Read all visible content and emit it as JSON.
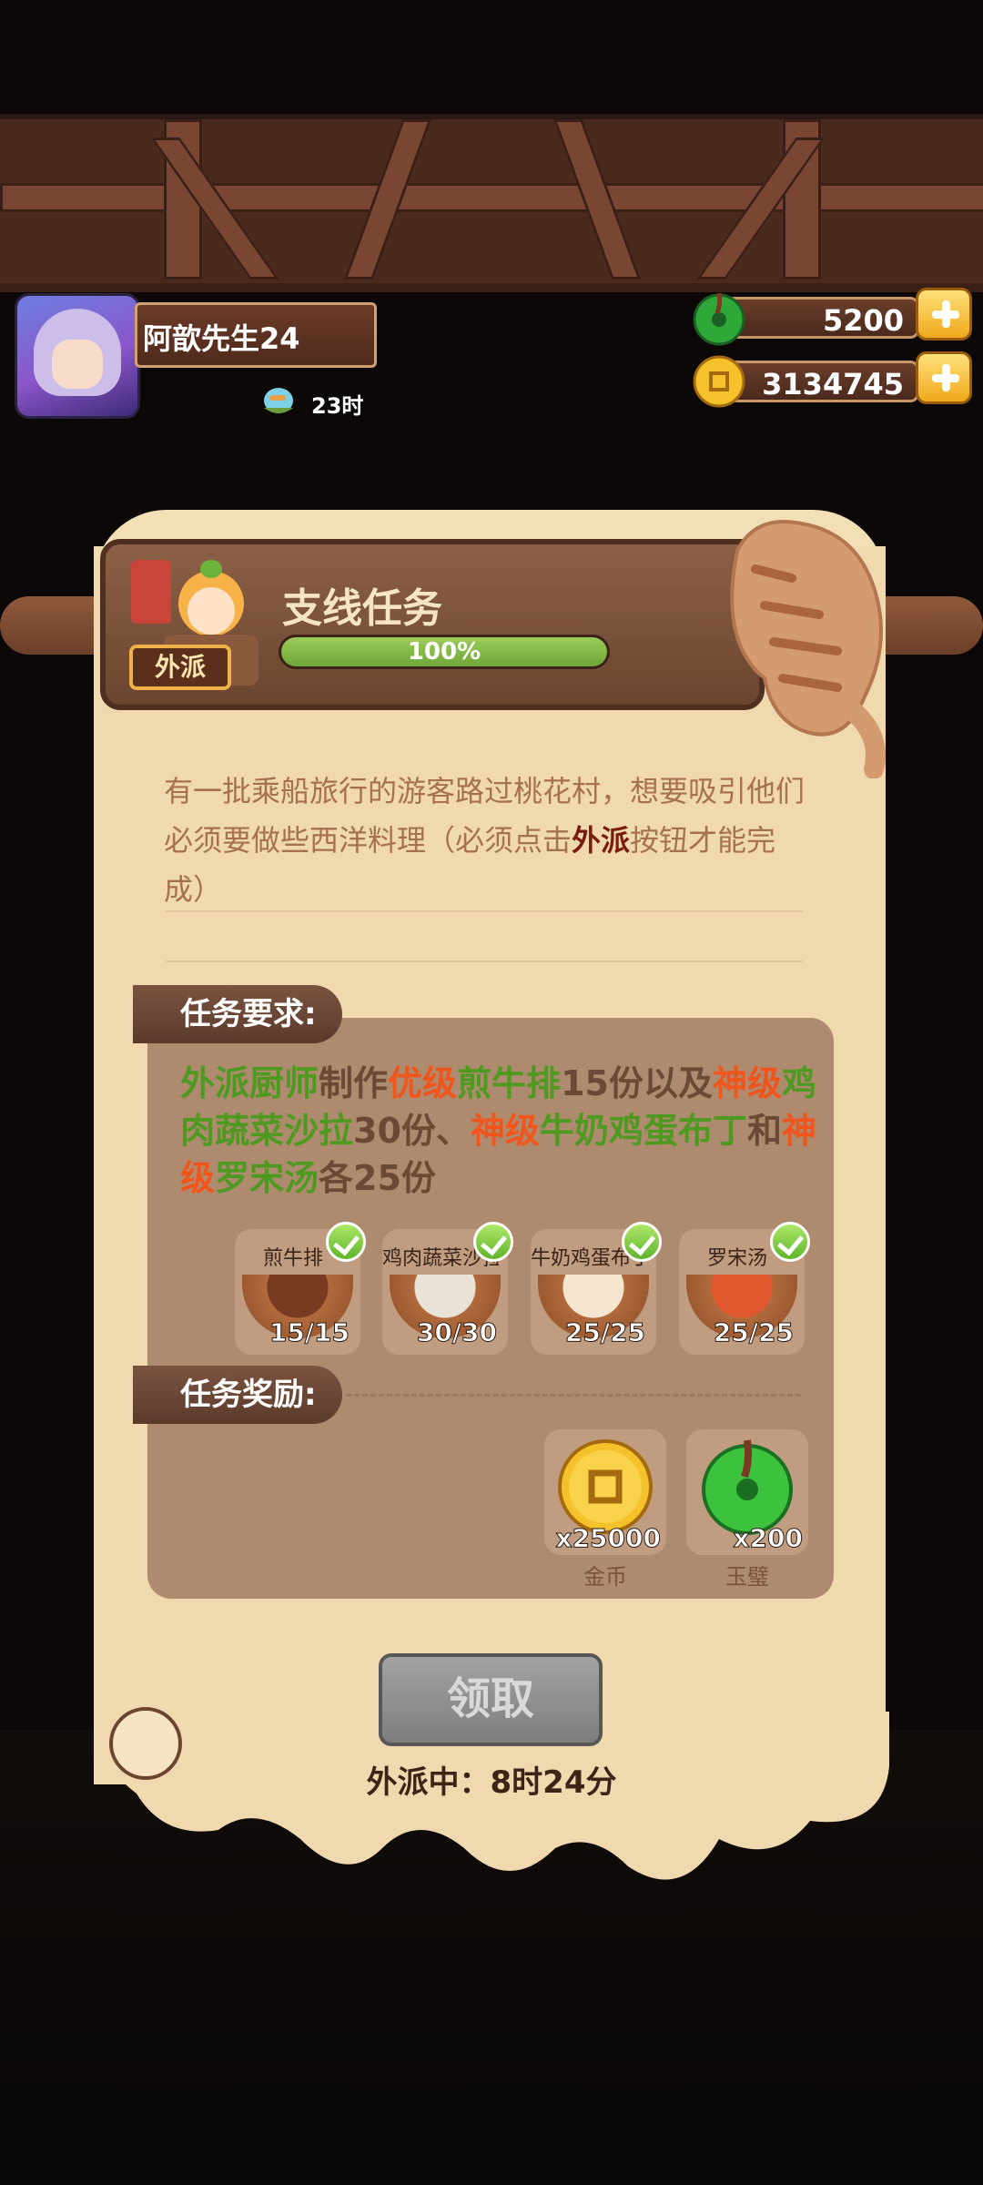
{
  "player": {
    "name": "阿歆先生24",
    "time_label": "23时"
  },
  "currencies": {
    "jade_amount": "5200",
    "gold_amount": "3134745"
  },
  "quest": {
    "badge": "外派",
    "title": "支线任务",
    "progress_text": "100%",
    "progress_fraction": 1.0,
    "description_part1": "有一批乘船旅行的游客路过桃花村，想要吸引他们必须要做些西洋料理（必须点击",
    "description_highlight": "外派",
    "description_part2": "按钮才能完成）",
    "requirements_tag": "任务要求:",
    "requirement_segments": [
      {
        "text": "外派厨师",
        "color": "g"
      },
      {
        "text": "制作",
        "color": "n"
      },
      {
        "text": "优级",
        "color": "o"
      },
      {
        "text": "煎牛排",
        "color": "g"
      },
      {
        "text": "15份以及",
        "color": "n"
      },
      {
        "text": "神级",
        "color": "o"
      },
      {
        "text": "鸡肉蔬菜沙拉",
        "color": "g"
      },
      {
        "text": "30份、",
        "color": "n"
      },
      {
        "text": "神级",
        "color": "o"
      },
      {
        "text": "牛奶鸡蛋布丁",
        "color": "g"
      },
      {
        "text": "和",
        "color": "n"
      },
      {
        "text": "神级",
        "color": "o"
      },
      {
        "text": "罗宋汤",
        "color": "g"
      },
      {
        "text": "各25份",
        "color": "n"
      }
    ],
    "foods": [
      {
        "name": "煎牛排",
        "count": "15/15",
        "color": "#7a3a22"
      },
      {
        "name": "鸡肉蔬菜沙拉",
        "count": "30/30",
        "color": "#e9e2d6"
      },
      {
        "name": "牛奶鸡蛋布丁",
        "count": "25/25",
        "color": "#f4e6cf"
      },
      {
        "name": "罗宋汤",
        "count": "25/25",
        "color": "#e0572e"
      }
    ],
    "rewards_tag": "任务奖励:",
    "rewards": [
      {
        "label": "金币",
        "count": "x25000"
      },
      {
        "label": "玉璧",
        "count": "x200"
      }
    ],
    "claim_button": "领取",
    "status_text": "外派中：8时24分"
  }
}
